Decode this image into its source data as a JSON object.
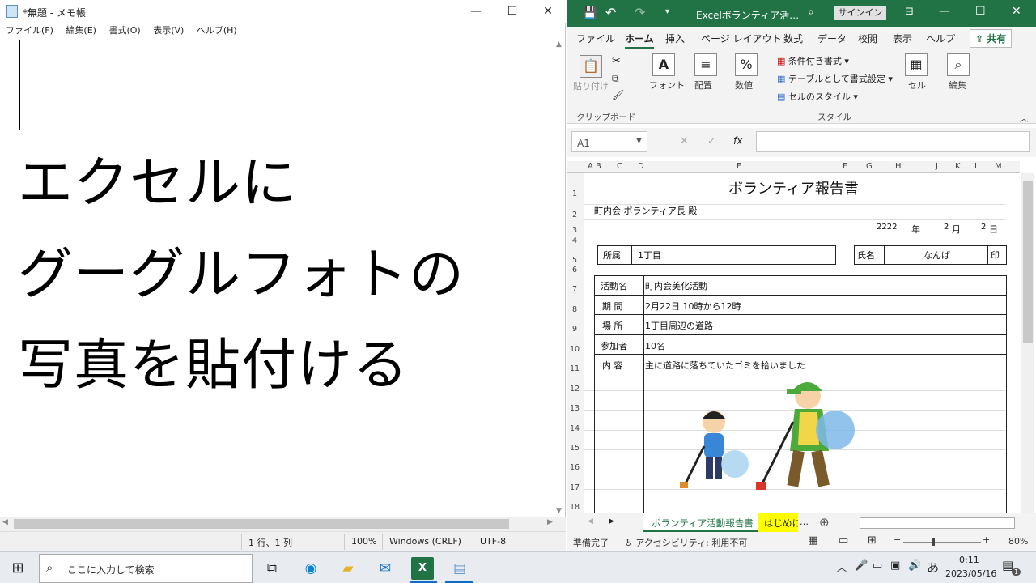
{
  "notepad": {
    "title": "*無題 - メモ帳",
    "menu": [
      "ファイル(F)",
      "編集(E)",
      "書式(O)",
      "表示(V)",
      "ヘルプ(H)"
    ],
    "text_lines": [
      "エクセルに",
      "グーグルフォトの",
      "写真を貼付ける"
    ],
    "status": {
      "position": "1 行、1 列",
      "zoom": "100%",
      "line_ending": "Windows (CRLF)",
      "encoding": "UTF-8"
    }
  },
  "excel": {
    "title": "Excelボランティア活…",
    "signin": "サインイン",
    "tabs": [
      "ファイル",
      "ホーム",
      "挿入",
      "ページ レイアウト",
      "数式",
      "データ",
      "校閲",
      "表示",
      "ヘルプ"
    ],
    "share": "共有",
    "ribbon": {
      "paste": "貼り付け",
      "font": "フォント",
      "align": "配置",
      "number": "数値",
      "cond_format": "条件付き書式",
      "table_format": "テーブルとして書式設定",
      "cell_style": "セルのスタイル",
      "cells": "セル",
      "edit": "編集",
      "group_clipboard": "クリップボード",
      "group_style": "スタイル"
    },
    "name_box": "A1",
    "fx": "fx",
    "columns": [
      "A",
      "B",
      "C",
      "D",
      "E",
      "F",
      "G",
      "H",
      "I",
      "J",
      "K",
      "L",
      "M"
    ],
    "rows": [
      "1",
      "2",
      "3",
      "4",
      "5",
      "6",
      "7",
      "8",
      "9",
      "10",
      "11",
      "12",
      "13",
      "14",
      "15",
      "16",
      "17",
      "18"
    ],
    "sheet": {
      "title": "ボランティア報告書",
      "addressee": "町内会 ボランティア長 殿",
      "year_val": "2222",
      "year_label": "年",
      "month_val": "2",
      "month_label": "月",
      "day_val": "2",
      "day_label": "日",
      "affil_label": "所属",
      "affil_val": "1丁目",
      "name_label": "氏名",
      "name_val": "なんば",
      "seal": "印",
      "items": [
        {
          "label": "活動名",
          "value": "町内会美化活動"
        },
        {
          "label": "期 間",
          "value": "2月22日 10時から12時"
        },
        {
          "label": "場 所",
          "value": "1丁目周辺の道路"
        },
        {
          "label": "参加者",
          "value": "10名"
        },
        {
          "label": "内 容",
          "value": "主に道路に落ちていたゴミを拾いました"
        }
      ]
    },
    "sheet_tabs": [
      "ボランティア活動報告書",
      "はじめに"
    ],
    "status_ready": "準備完了",
    "accessibility": "アクセシビリティ: 利用不可",
    "zoom": "80%"
  },
  "taskbar": {
    "search_placeholder": "ここに入力して検索",
    "ime": "あ",
    "time": "0:11",
    "date": "2023/05/16",
    "notif_count": "1"
  }
}
